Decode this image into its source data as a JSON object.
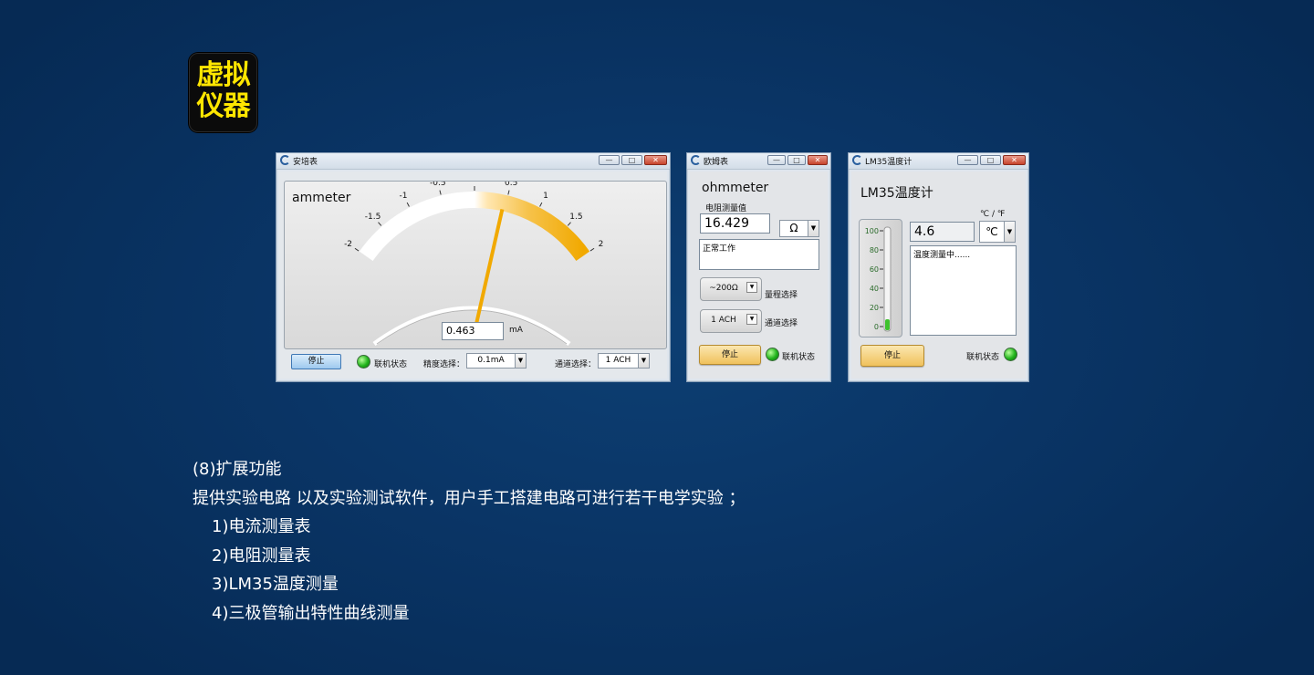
{
  "badge": {
    "line1": "虚拟",
    "line2": "仪器"
  },
  "ammeter": {
    "window_title": "安培表",
    "panel_title": "ammeter",
    "ticks": [
      "-2",
      "-1.5",
      "-1",
      "-0.5",
      "0",
      "0.5",
      "1",
      "1.5",
      "2"
    ],
    "needle_value": 0.463,
    "reading": "0.463",
    "unit": "mA",
    "stop_label": "停止",
    "online_label": "联机状态",
    "precision_label": "精度选择：",
    "precision_value": "0.1mA",
    "channel_label": "通道选择：",
    "channel_value": "1 ACH"
  },
  "ohmmeter": {
    "window_title": "欧姆表",
    "panel_title": "ohmmeter",
    "measure_label": "电阻测量值",
    "reading": "16.429",
    "unit": "Ω",
    "status_text": "正常工作",
    "range_button": "~200Ω",
    "range_label": "量程选择",
    "channel_button": "1 ACH",
    "channel_label": "通道选择",
    "stop_label": "停止",
    "online_label": "联机状态"
  },
  "lm35": {
    "window_title": "LM35温度计",
    "panel_title": "LM35温度计",
    "unit_toggle_label": "℃ / ℉",
    "scale": [
      "100",
      "80",
      "60",
      "40",
      "20",
      "0"
    ],
    "level": 4.6,
    "reading": "4.6",
    "unit": "℃",
    "status_text": "温度测量中......",
    "stop_label": "停止",
    "online_label": "联机状态"
  },
  "description": {
    "heading": "(8)扩展功能",
    "intro": "提供实验电路 以及实验测试软件，用户手工搭建电路可进行若干电学实验 ；",
    "items": [
      "1)电流测量表",
      "2)电阻测量表",
      "3)LM35温度测量",
      "4)三极管输出特性曲线测量"
    ]
  },
  "window_buttons": {
    "minimize": "—",
    "maximize": "□",
    "close": "✕"
  }
}
